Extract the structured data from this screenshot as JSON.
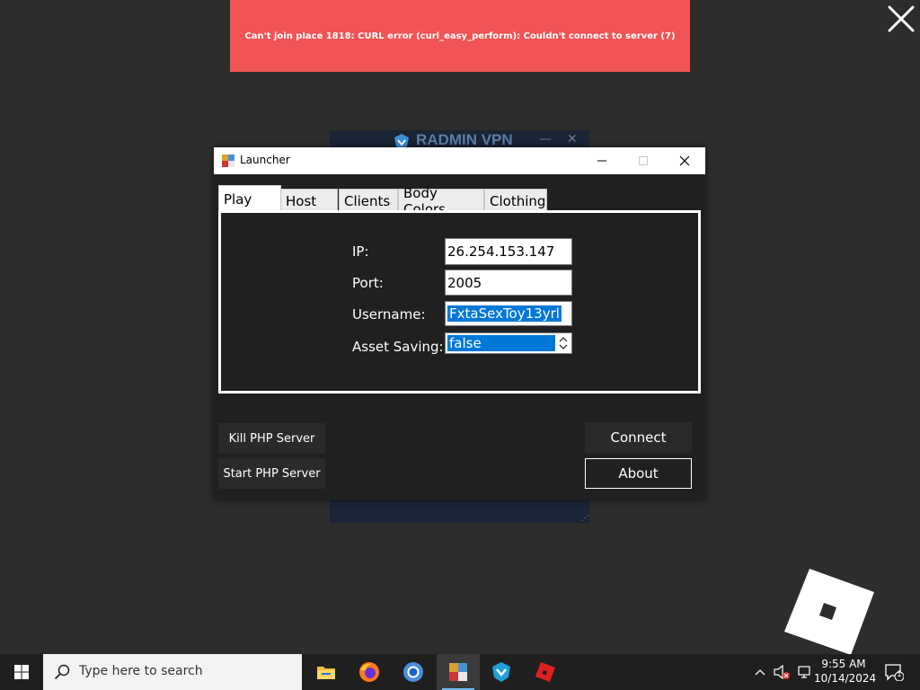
{
  "error_banner": {
    "text": "Can't join place 1818: CURL error (curl_easy_perform): Couldn't connect to server (7)",
    "color": "#f05454"
  },
  "background_window": {
    "title": "RADMIN VPN"
  },
  "launcher": {
    "title": "Launcher",
    "tabs": [
      "Play",
      "Host",
      "Clients",
      "Body Colors",
      "Clothing"
    ],
    "active_tab": "Play",
    "form": {
      "ip_label": "IP:",
      "ip_value": "26.254.153.147",
      "port_label": "Port:",
      "port_value": "2005",
      "username_label": "Username:",
      "username_value": "FxtaSexToy13yrl",
      "asset_saving_label": "Asset Saving:",
      "asset_saving_value": "false"
    },
    "buttons": {
      "kill_php": "Kill PHP Server",
      "start_php": "Start PHP Server",
      "connect": "Connect",
      "about": "About"
    }
  },
  "taskbar": {
    "search_placeholder": "Type here to search",
    "apps": [
      "file-explorer-icon",
      "firefox-icon",
      "chrome-icon",
      "launcher-icon",
      "radmin-vpn-icon",
      "roblox-icon"
    ],
    "time": "9:55 AM",
    "date": "10/14/2024",
    "notification_count": "1"
  },
  "colors": {
    "desktop": "#2d2d2d",
    "accent": "#0078d7",
    "error": "#f05454"
  }
}
